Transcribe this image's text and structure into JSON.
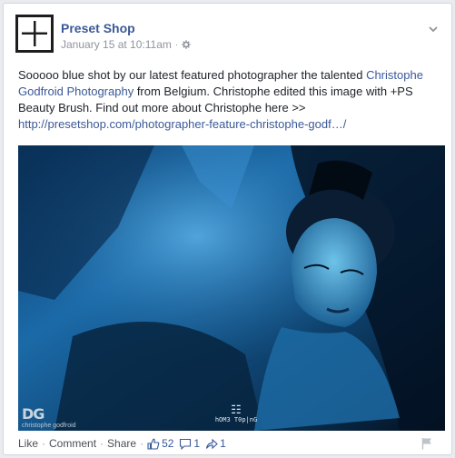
{
  "post": {
    "page_name": "Preset Shop",
    "timestamp": "January 15 at 10:11am",
    "text_1": "Sooooo blue shot by our latest featured photographer the talented ",
    "link_1": "Christophe Godfroid Photography",
    "text_2": " from Belgium. Christophe edited this image with +PS Beauty Brush. Find out more about Christophe here >> ",
    "link_2": "http://presetshop.com/photographer-feature-christophe-godf…/"
  },
  "photo": {
    "watermark_left_logo": "DG",
    "watermark_left_text": "christophe godfroid",
    "watermark_center_text": "hOM3 T0p|nG"
  },
  "actions": {
    "like_label": "Like",
    "comment_label": "Comment",
    "share_label": "Share",
    "separator": "·",
    "likes_count": "52",
    "comments_count": "1",
    "shares_count": "1"
  },
  "colors": {
    "link": "#3b5998",
    "photo_tint": "#1a6fb5"
  }
}
